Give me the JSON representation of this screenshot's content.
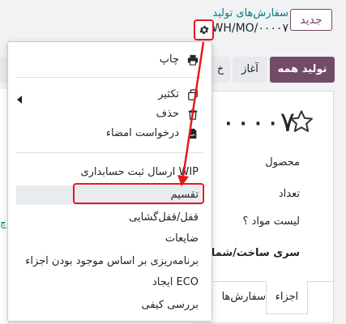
{
  "header": {
    "new_button": "جدید",
    "breadcrumb_parent": "سفارش‌های تولید",
    "breadcrumb_current": "WH/MO/۰۰۰۰۷",
    "gear_icon": "gear-icon"
  },
  "status_bar": {
    "produce_all": "تولید همه",
    "start": "آغاز",
    "partial": "خ"
  },
  "record": {
    "title": "۰۰۰۰۷",
    "fields": {
      "product": "محصول",
      "quantity": "تعداد",
      "bom": "لیست مواد ؟",
      "lot": "سری ساخت/شماره سر"
    },
    "tabs": {
      "components": "اجزاء",
      "work_orders": "سفارش‌ها"
    }
  },
  "menu": {
    "print": "چاپ",
    "duplicate": "تکثیر",
    "delete": "حذف",
    "request_signature": "درخواست امضاء",
    "wip_accounting": "ارسال ثبت حسابداری WIP",
    "split": "تقسیم",
    "lock_unlock": "قفل/قفل‌گشایی",
    "scrap": "ضایعات",
    "plan_by_components": "برنامه‌ریزی بر اساس موجود بودن اجزاء",
    "create_eco": "ایجاد ECO",
    "quality_check": "بررسی کیفی"
  },
  "colors": {
    "brand": "#714b67",
    "teal": "#017e84",
    "annotation_red": "#e4181d"
  }
}
